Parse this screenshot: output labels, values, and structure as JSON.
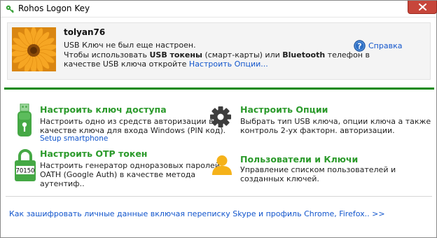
{
  "window": {
    "title": "Rohos Logon Key"
  },
  "header": {
    "username": "tolyan76",
    "line1": "USB Ключ не был еще настроен.",
    "line2_pre": "Чтобы использовать ",
    "line2_bold1": "USB токены",
    "line2_mid": " (смарт-карты) или ",
    "line2_bold2": "Bluetooth",
    "line2_post": " телефон в",
    "line3_pre": "качестве USB ключа откройте ",
    "line3_link": "Настроить Опции...",
    "help_label": "Справка"
  },
  "items": {
    "access_key": {
      "title": "Настроить ключ доступа",
      "desc_line1": "Настроить одно из средств авторизации в",
      "desc_line2": "качестве ключа для входа Windows (PIN код).",
      "sub_link": "Setup smartphone"
    },
    "otp": {
      "title": "Настроить OTP токен",
      "desc_line1": "Настроить генератор одноразовых паролей",
      "desc_line2": "OATH (Google Auth) в качестве метода",
      "desc_line3": "аутентиф..",
      "icon_code": "70150"
    },
    "options": {
      "title": "Настроить Опции",
      "desc_line1": "Выбрать тип USB ключа, опции ключа а также",
      "desc_line2": "контроль 2-ух факторн. авторизации."
    },
    "users": {
      "title": "Пользователи и Ключи",
      "desc_line1": "Управление списком пользователей и",
      "desc_line2": "созданных ключей."
    }
  },
  "footer": {
    "link": "Как зашифровать личные данные включая переписку Skype и профиль Chrome, Firefox.. >>"
  },
  "colors": {
    "accent_green": "#2b9a2b",
    "divider_green": "#118a11",
    "link_blue": "#1155cc",
    "close_red": "#c7463b"
  },
  "icons": {
    "app": "green-key-icon",
    "close": "close-icon",
    "help": "help-icon",
    "access_key": "usb-key-icon",
    "otp": "otp-lock-icon",
    "options": "gear-icon",
    "users": "user-icon"
  }
}
